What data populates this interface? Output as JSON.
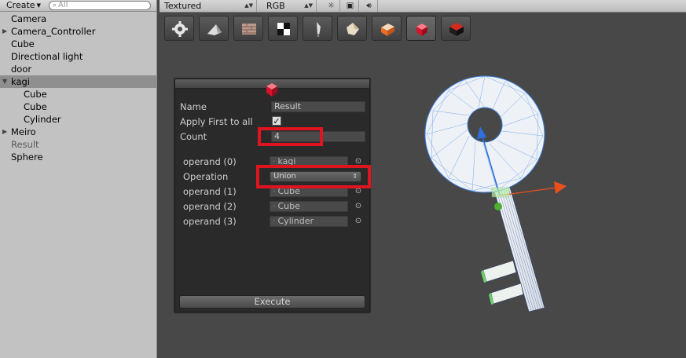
{
  "hierarchy": {
    "create_label": "Create",
    "search_placeholder": "All",
    "items": [
      {
        "label": "Camera"
      },
      {
        "label": "Camera_Controller"
      },
      {
        "label": "Cube"
      },
      {
        "label": "Directional light"
      },
      {
        "label": "door"
      },
      {
        "label": "kagi"
      },
      {
        "label": "Cube"
      },
      {
        "label": "Cube"
      },
      {
        "label": "Cylinder"
      },
      {
        "label": "Meiro"
      },
      {
        "label": "Result"
      },
      {
        "label": "Sphere"
      }
    ]
  },
  "scene_toolbar": {
    "render_mode": "Textured",
    "color_mode": "RGB"
  },
  "csg_panel": {
    "name_label": "Name",
    "name_value": "Result",
    "apply_first_label": "Apply First to all",
    "apply_first_checked": true,
    "count_label": "Count",
    "count_value": "4",
    "operand0_label": "operand (0)",
    "operand0_value": "kagi",
    "operation_label": "Operation",
    "operation_value": "Union",
    "operand1_label": "operand (1)",
    "operand1_value": "Cube",
    "operand2_label": "operand (2)",
    "operand2_value": "Cube",
    "operand3_label": "operand (3)",
    "operand3_value": "Cylinder",
    "execute_label": "Execute"
  },
  "colors": {
    "highlight": "#e0141e",
    "panel_bg": "#2a2a2a",
    "scene_bg": "#484848",
    "selected_row": "#8f8f8f",
    "wire": "#3a7fe0",
    "axis_y": "#2f6fe0",
    "axis_x": "#e8501e",
    "axis_center": "#4caf30"
  },
  "icons": {
    "tools": [
      "gear-icon",
      "terrain-raise-icon",
      "brick-texture-icon",
      "checker-paint-icon",
      "tree-brush-icon",
      "detail-paint-icon",
      "settings-box-icon",
      "csg-cube-icon",
      "black-box-icon"
    ],
    "toolbar": [
      "sun-icon",
      "image-icon",
      "speaker-icon"
    ]
  }
}
